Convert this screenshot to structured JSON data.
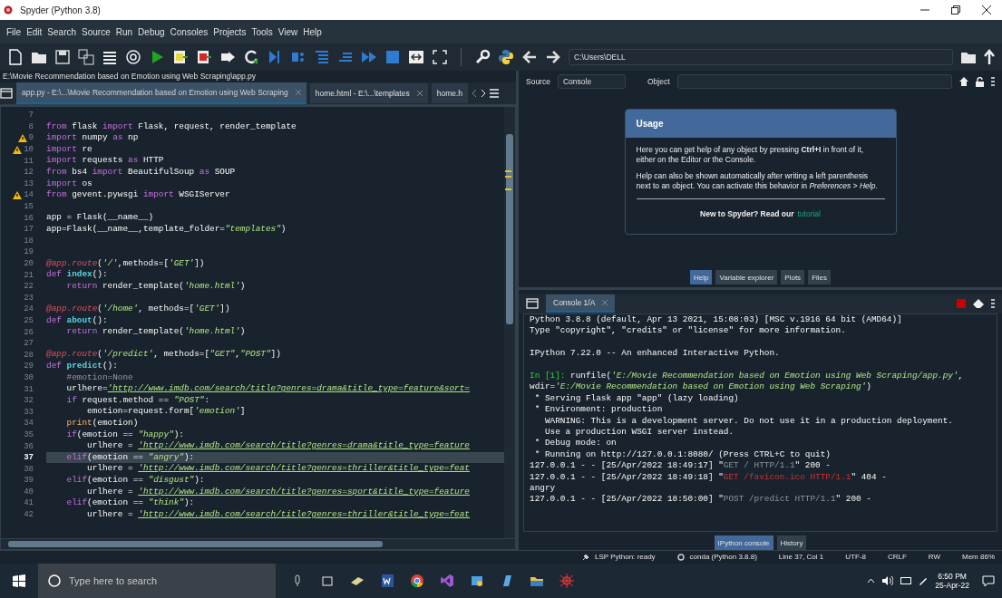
{
  "window": {
    "title": "Spyder (Python 3.8)"
  },
  "menu": [
    "File",
    "Edit",
    "Search",
    "Source",
    "Run",
    "Debug",
    "Consoles",
    "Projects",
    "Tools",
    "View",
    "Help"
  ],
  "path_bar": {
    "value": "C:\\Users\\DELL"
  },
  "editor": {
    "file_path": "E:\\Movie Recommendation based on Emotion using Web Scraping\\app.py",
    "tabs": [
      {
        "label": "app.py - E:\\...\\Movie Recommendation based on Emotion using Web Scraping",
        "selected": true,
        "closable": true
      },
      {
        "label": "home.html - E:\\...\\templates",
        "selected": false,
        "closable": true
      },
      {
        "label": "home.h",
        "selected": false,
        "closable": false
      }
    ],
    "lines": [
      {
        "number": "7",
        "warning": false,
        "current": false
      },
      {
        "number": "8",
        "warning": false,
        "current": false,
        "tokens": [
          {
            "kind": "k",
            "text": "from"
          },
          {
            "kind": "p",
            "text": " flask "
          },
          {
            "kind": "k",
            "text": "import"
          },
          {
            "kind": "p",
            "text": " Flask, request, render_template"
          }
        ]
      },
      {
        "number": "9",
        "warning": true,
        "current": false,
        "tokens": [
          {
            "kind": "k",
            "text": "import"
          },
          {
            "kind": "p",
            "text": " numpy "
          },
          {
            "kind": "k",
            "text": "as"
          },
          {
            "kind": "p",
            "text": " np"
          }
        ]
      },
      {
        "number": "10",
        "warning": true,
        "current": false,
        "tokens": [
          {
            "kind": "k",
            "text": "import"
          },
          {
            "kind": "p",
            "text": " re"
          }
        ]
      },
      {
        "number": "11",
        "warning": false,
        "current": false,
        "tokens": [
          {
            "kind": "k",
            "text": "import"
          },
          {
            "kind": "p",
            "text": " requests "
          },
          {
            "kind": "k",
            "text": "as"
          },
          {
            "kind": "p",
            "text": " HTTP"
          }
        ]
      },
      {
        "number": "12",
        "warning": false,
        "current": false,
        "tokens": [
          {
            "kind": "k",
            "text": "from"
          },
          {
            "kind": "p",
            "text": " bs4 "
          },
          {
            "kind": "k",
            "text": "import"
          },
          {
            "kind": "p",
            "text": " BeautifulSoup "
          },
          {
            "kind": "k",
            "text": "as"
          },
          {
            "kind": "p",
            "text": " SOUP"
          }
        ]
      },
      {
        "number": "13",
        "warning": false,
        "current": false,
        "tokens": [
          {
            "kind": "k",
            "text": "import"
          },
          {
            "kind": "p",
            "text": " os"
          }
        ]
      },
      {
        "number": "14",
        "warning": true,
        "current": false,
        "tokens": [
          {
            "kind": "k",
            "text": "from"
          },
          {
            "kind": "p",
            "text": " gevent.pywsgi "
          },
          {
            "kind": "k",
            "text": "import"
          },
          {
            "kind": "p",
            "text": " WSGIServer"
          }
        ]
      },
      {
        "number": "15",
        "warning": false,
        "current": false
      },
      {
        "number": "16",
        "warning": false,
        "current": false,
        "tokens": [
          {
            "kind": "p",
            "text": "app = Flask(__name__)"
          }
        ]
      },
      {
        "number": "17",
        "warning": false,
        "current": false,
        "tokens": [
          {
            "kind": "p",
            "text": "app=Flask(__name__,template_folder="
          },
          {
            "kind": "s",
            "text": "\"templates\""
          },
          {
            "kind": "p",
            "text": ")"
          }
        ]
      },
      {
        "number": "18",
        "warning": false,
        "current": false
      },
      {
        "number": "19",
        "warning": false,
        "current": false
      },
      {
        "number": "20",
        "warning": false,
        "current": false,
        "tokens": [
          {
            "kind": "d",
            "text": "@app.route"
          },
          {
            "kind": "p",
            "text": "("
          },
          {
            "kind": "s",
            "text": "'/'"
          },
          {
            "kind": "p",
            "text": ",methods=["
          },
          {
            "kind": "s",
            "text": "'GET'"
          },
          {
            "kind": "p",
            "text": "])"
          }
        ]
      },
      {
        "number": "21",
        "warning": false,
        "current": false,
        "tokens": [
          {
            "kind": "k",
            "text": "def "
          },
          {
            "kind": "f",
            "text": "index"
          },
          {
            "kind": "p",
            "text": "():"
          }
        ]
      },
      {
        "number": "22",
        "warning": false,
        "current": false,
        "tokens": [
          {
            "kind": "k",
            "text": "    return"
          },
          {
            "kind": "p",
            "text": " render_template("
          },
          {
            "kind": "s",
            "text": "'home.html'"
          },
          {
            "kind": "p",
            "text": ")"
          }
        ]
      },
      {
        "number": "23",
        "warning": false,
        "current": false
      },
      {
        "number": "24",
        "warning": false,
        "current": false,
        "tokens": [
          {
            "kind": "d",
            "text": "@app.route"
          },
          {
            "kind": "p",
            "text": "("
          },
          {
            "kind": "s",
            "text": "'/home'"
          },
          {
            "kind": "p",
            "text": ", methods=["
          },
          {
            "kind": "s",
            "text": "'GET'"
          },
          {
            "kind": "p",
            "text": "])"
          }
        ]
      },
      {
        "number": "25",
        "warning": false,
        "current": false,
        "tokens": [
          {
            "kind": "k",
            "text": "def "
          },
          {
            "kind": "f",
            "text": "about"
          },
          {
            "kind": "p",
            "text": "():"
          }
        ]
      },
      {
        "number": "26",
        "warning": false,
        "current": false,
        "tokens": [
          {
            "kind": "k",
            "text": "    return"
          },
          {
            "kind": "p",
            "text": " render_template("
          },
          {
            "kind": "s",
            "text": "'home.html'"
          },
          {
            "kind": "p",
            "text": ")"
          }
        ]
      },
      {
        "number": "27",
        "warning": false,
        "current": false
      },
      {
        "number": "28",
        "warning": false,
        "current": false,
        "tokens": [
          {
            "kind": "d",
            "text": "@app.route"
          },
          {
            "kind": "p",
            "text": "("
          },
          {
            "kind": "s",
            "text": "'/predict'"
          },
          {
            "kind": "p",
            "text": ", methods=["
          },
          {
            "kind": "s",
            "text": "\"GET\""
          },
          {
            "kind": "p",
            "text": ","
          },
          {
            "kind": "s",
            "text": "\"POST\""
          },
          {
            "kind": "p",
            "text": "])"
          }
        ]
      },
      {
        "number": "29",
        "warning": false,
        "current": false,
        "tokens": [
          {
            "kind": "k",
            "text": "def "
          },
          {
            "kind": "f",
            "text": "predict"
          },
          {
            "kind": "p",
            "text": "():"
          }
        ]
      },
      {
        "number": "30",
        "warning": false,
        "current": false,
        "tokens": [
          {
            "kind": "c",
            "text": "    #emotion=None"
          }
        ]
      },
      {
        "number": "31",
        "warning": false,
        "current": false,
        "tokens": [
          {
            "kind": "p",
            "text": "    urlhere="
          },
          {
            "kind": "u",
            "text": "'http://www.imdb.com/search/title?genres=drama&title_type=feature&sort="
          }
        ]
      },
      {
        "number": "32",
        "warning": false,
        "current": false,
        "tokens": [
          {
            "kind": "k",
            "text": "    if"
          },
          {
            "kind": "p",
            "text": " request.method == "
          },
          {
            "kind": "s",
            "text": "\"POST\""
          },
          {
            "kind": "p",
            "text": ":"
          }
        ]
      },
      {
        "number": "33",
        "warning": false,
        "current": false,
        "tokens": [
          {
            "kind": "p",
            "text": "        emotion=request.form["
          },
          {
            "kind": "s",
            "text": "'emotion'"
          },
          {
            "kind": "p",
            "text": "]"
          }
        ]
      },
      {
        "number": "34",
        "warning": false,
        "current": false,
        "tokens": [
          {
            "kind": "b",
            "text": "    print"
          },
          {
            "kind": "p",
            "text": "(emotion)"
          }
        ]
      },
      {
        "number": "35",
        "warning": false,
        "current": false,
        "tokens": [
          {
            "kind": "k",
            "text": "    if"
          },
          {
            "kind": "p",
            "text": "(emotion == "
          },
          {
            "kind": "s",
            "text": "\"happy\""
          },
          {
            "kind": "p",
            "text": "):"
          }
        ]
      },
      {
        "number": "36",
        "warning": false,
        "current": false,
        "tokens": [
          {
            "kind": "p",
            "text": "        urlhere = "
          },
          {
            "kind": "u",
            "text": "'http://www.imdb.com/search/title?genres=drama&title_type=feature"
          }
        ]
      },
      {
        "number": "37",
        "warning": false,
        "current": true,
        "tokens": [
          {
            "kind": "k",
            "text": "    elif"
          },
          {
            "kind": "p",
            "text": "(emotion == "
          },
          {
            "kind": "s",
            "text": "\"angry\""
          },
          {
            "kind": "p",
            "text": "):"
          }
        ]
      },
      {
        "number": "38",
        "warning": false,
        "current": false,
        "tokens": [
          {
            "kind": "p",
            "text": "        urlhere = "
          },
          {
            "kind": "u",
            "text": "'http://www.imdb.com/search/title?genres=thriller&title_type=feat"
          }
        ]
      },
      {
        "number": "39",
        "warning": false,
        "current": false,
        "tokens": [
          {
            "kind": "k",
            "text": "    elif"
          },
          {
            "kind": "p",
            "text": "(emotion == "
          },
          {
            "kind": "s",
            "text": "\"disgust\""
          },
          {
            "kind": "p",
            "text": "):"
          }
        ]
      },
      {
        "number": "40",
        "warning": false,
        "current": false,
        "tokens": [
          {
            "kind": "p",
            "text": "        urlhere = "
          },
          {
            "kind": "u",
            "text": "'http://www.imdb.com/search/title?genres=sport&title_type=feature"
          }
        ]
      },
      {
        "number": "41",
        "warning": false,
        "current": false,
        "tokens": [
          {
            "kind": "k",
            "text": "    elif"
          },
          {
            "kind": "p",
            "text": "(emotion == "
          },
          {
            "kind": "s",
            "text": "\"think\""
          },
          {
            "kind": "p",
            "text": "):"
          }
        ]
      },
      {
        "number": "42",
        "warning": false,
        "current": false,
        "tokens": [
          {
            "kind": "p",
            "text": "        urlhere = "
          },
          {
            "kind": "u",
            "text": "'http://www.imdb.com/search/title?genres=thriller&title_type=feat"
          }
        ]
      }
    ]
  },
  "help": {
    "source_label": "Source",
    "source_value": "Console",
    "object_label": "Object",
    "usage": {
      "title": "Usage",
      "paragraphs": [
        "Here you can get help of any object by pressing **Ctrl+I** in front of it, either on the Editor or the Console.",
        "Help can also be shown automatically after writing a left parenthesis next to an object. You can activate this behavior in *Preferences > Help*."
      ],
      "footer": "New to Spyder? Read our",
      "link": "tutorial"
    },
    "tabs": [
      {
        "label": "Help",
        "selected": true
      },
      {
        "label": "Variable explorer",
        "selected": false
      },
      {
        "label": "Plots",
        "selected": false
      },
      {
        "label": "Files",
        "selected": false
      }
    ]
  },
  "console": {
    "tab": "Console 1/A",
    "lines": [
      {
        "space_before": false,
        "segments": [
          {
            "kind": "p",
            "text": "Python 3.8.8 (default, Apr 13 2021, 15:08:03) [MSC v.1916 64 bit (AMD64)]"
          }
        ]
      },
      {
        "space_before": false,
        "segments": [
          {
            "kind": "p",
            "text": "Type \"copyright\", \"credits\" or \"license\" for more information."
          }
        ]
      },
      {
        "space_before": true,
        "segments": [
          {
            "kind": "p",
            "text": "IPython 7.22.0 -- An enhanced Interactive Python."
          }
        ]
      },
      {
        "space_before": true,
        "segments": [
          {
            "kind": "g",
            "text": "In [1]:"
          },
          {
            "kind": "p",
            "text": " runfile("
          },
          {
            "kind": "s",
            "text": "'E:/Movie Recommendation based on Emotion using Web Scraping/app.py'"
          },
          {
            "kind": "p",
            "text": ","
          }
        ]
      },
      {
        "space_before": false,
        "segments": [
          {
            "kind": "p",
            "text": "wdir="
          },
          {
            "kind": "s",
            "text": "'E:/Movie Recommendation based on Emotion using Web Scraping'"
          },
          {
            "kind": "p",
            "text": ")"
          }
        ]
      },
      {
        "space_before": false,
        "segments": [
          {
            "kind": "p",
            "text": " * Serving Flask app \"app\" (lazy loading)"
          }
        ]
      },
      {
        "space_before": false,
        "segments": [
          {
            "kind": "p",
            "text": " * Environment: production"
          }
        ]
      },
      {
        "space_before": false,
        "segments": [
          {
            "kind": "p",
            "text": "   WARNING: This is a development server. Do not use it in a production deployment."
          }
        ]
      },
      {
        "space_before": false,
        "segments": [
          {
            "kind": "p",
            "text": "   Use a production WSGI server instead."
          }
        ]
      },
      {
        "space_before": false,
        "segments": [
          {
            "kind": "p",
            "text": " * Debug mode: on"
          }
        ]
      },
      {
        "space_before": false,
        "segments": [
          {
            "kind": "p",
            "text": " * Running on http://127.0.0.1:8080/ (Press CTRL+C to quit)"
          }
        ]
      },
      {
        "space_before": false,
        "segments": [
          {
            "kind": "p",
            "text": "127.0.0.1 - - [25/Apr/2022 18:49:17] \""
          },
          {
            "kind": "m",
            "text": "GET / HTTP/1.1"
          },
          {
            "kind": "p",
            "text": "\" 200 -"
          }
        ]
      },
      {
        "space_before": false,
        "segments": [
          {
            "kind": "p",
            "text": "127.0.0.1 - - [25/Apr/2022 18:49:18] \""
          },
          {
            "kind": "r",
            "text": "GET /favicon.ico HTTP/1.1"
          },
          {
            "kind": "p",
            "text": "\" 404 -"
          }
        ]
      },
      {
        "space_before": false,
        "segments": [
          {
            "kind": "p",
            "text": "angry"
          }
        ]
      },
      {
        "space_before": false,
        "segments": [
          {
            "kind": "p",
            "text": "127.0.0.1 - - [25/Apr/2022 18:50:00] \""
          },
          {
            "kind": "m",
            "text": "POST /predict HTTP/1.1"
          },
          {
            "kind": "p",
            "text": "\" 200 -"
          }
        ]
      }
    ],
    "tabs": [
      {
        "label": "IPython console",
        "selected": true
      },
      {
        "label": "History",
        "selected": false
      }
    ]
  },
  "status_bar": [
    {
      "kind": "lsp",
      "text": "LSP Python: ready"
    },
    {
      "kind": "conda",
      "text": "conda (Python 3.8.8)"
    },
    {
      "kind": "plain",
      "text": "Line 37, Col 1"
    },
    {
      "kind": "plain",
      "text": "UTF-8"
    },
    {
      "kind": "plain",
      "text": "CRLF"
    },
    {
      "kind": "plain",
      "text": "RW"
    },
    {
      "kind": "plain",
      "text": "Mem 86%"
    }
  ],
  "taskbar": {
    "search_placeholder": "Type here to search",
    "time": "6:50 PM",
    "date": "25-Apr-22"
  }
}
